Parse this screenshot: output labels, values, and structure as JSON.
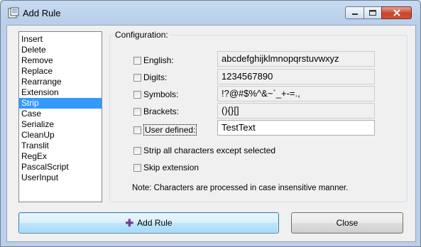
{
  "window": {
    "title": "Add Rule"
  },
  "rules": [
    "Insert",
    "Delete",
    "Remove",
    "Replace",
    "Rearrange",
    "Extension",
    "Strip",
    "Case",
    "Serialize",
    "CleanUp",
    "Translit",
    "RegEx",
    "PascalScript",
    "UserInput"
  ],
  "selected_rule": "Strip",
  "configuration": {
    "label": "Configuration:",
    "options": [
      {
        "label": "English:",
        "value": "abcdefghijklmnopqrstuvwxyz",
        "checked": false
      },
      {
        "label": "Digits:",
        "value": "1234567890",
        "checked": false
      },
      {
        "label": "Symbols:",
        "value": "!?@#$%^&~`_+-=.,",
        "checked": false
      },
      {
        "label": "Brackets:",
        "value": "(){}[]",
        "checked": false
      },
      {
        "label": "User defined:",
        "value": "TestText",
        "checked": false
      }
    ],
    "strip_all_label": "Strip all characters except selected",
    "skip_extension_label": "Skip extension",
    "note": "Note: Characters are processed in case insensitive manner."
  },
  "buttons": {
    "add_rule": "Add Rule",
    "close": "Close"
  }
}
